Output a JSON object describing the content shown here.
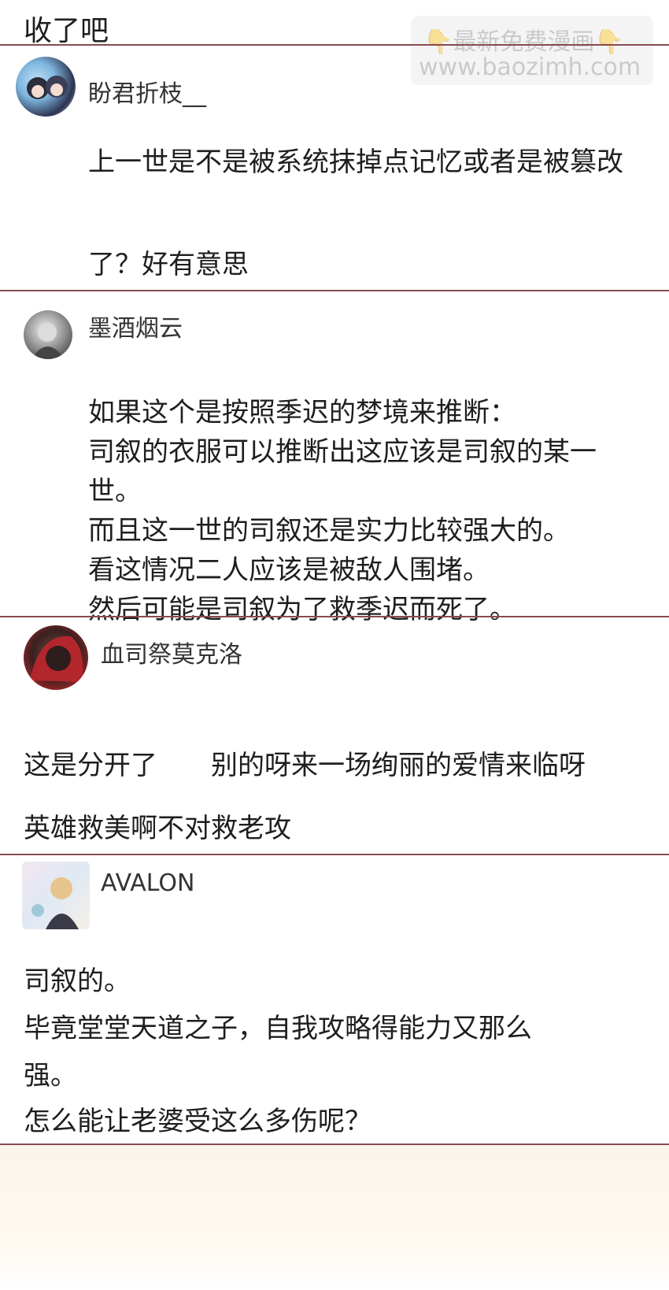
{
  "top": {
    "text": "收了吧"
  },
  "watermark": {
    "line1": "👇最新免费漫画👇",
    "line2": "www.baozimh.com"
  },
  "comments": [
    {
      "username": "盼君折枝__",
      "lines": [
        "上一世是不是被系统抹掉点记忆或者是被篡改",
        "了？好有意思"
      ]
    },
    {
      "username": "墨酒烟云",
      "lines": [
        "如果这个是按照季迟的梦境来推断：",
        "司叙的衣服可以推断出这应该是司叙的某一",
        "世。",
        "而且这一世的司叙还是实力比较强大的。",
        "看这情况二人应该是被敌人围堵。",
        "然后可能是司叙为了救季迟而死了。"
      ]
    },
    {
      "username": "血司祭莫克洛",
      "lines": [
        "这是分开了　　别的呀来一场绚丽的爱情来临呀",
        "英雄救美啊不对救老攻"
      ]
    },
    {
      "username": "AVALON",
      "lines": [
        "司叙的。",
        "毕竟堂堂天道之子，自我攻略得能力又那么",
        "强。",
        "怎么能让老婆受这么多伤呢？"
      ]
    }
  ],
  "colors": {
    "divider": "#8a4a4e",
    "text": "#1e1e1e",
    "footer": "#fbf4ea"
  }
}
